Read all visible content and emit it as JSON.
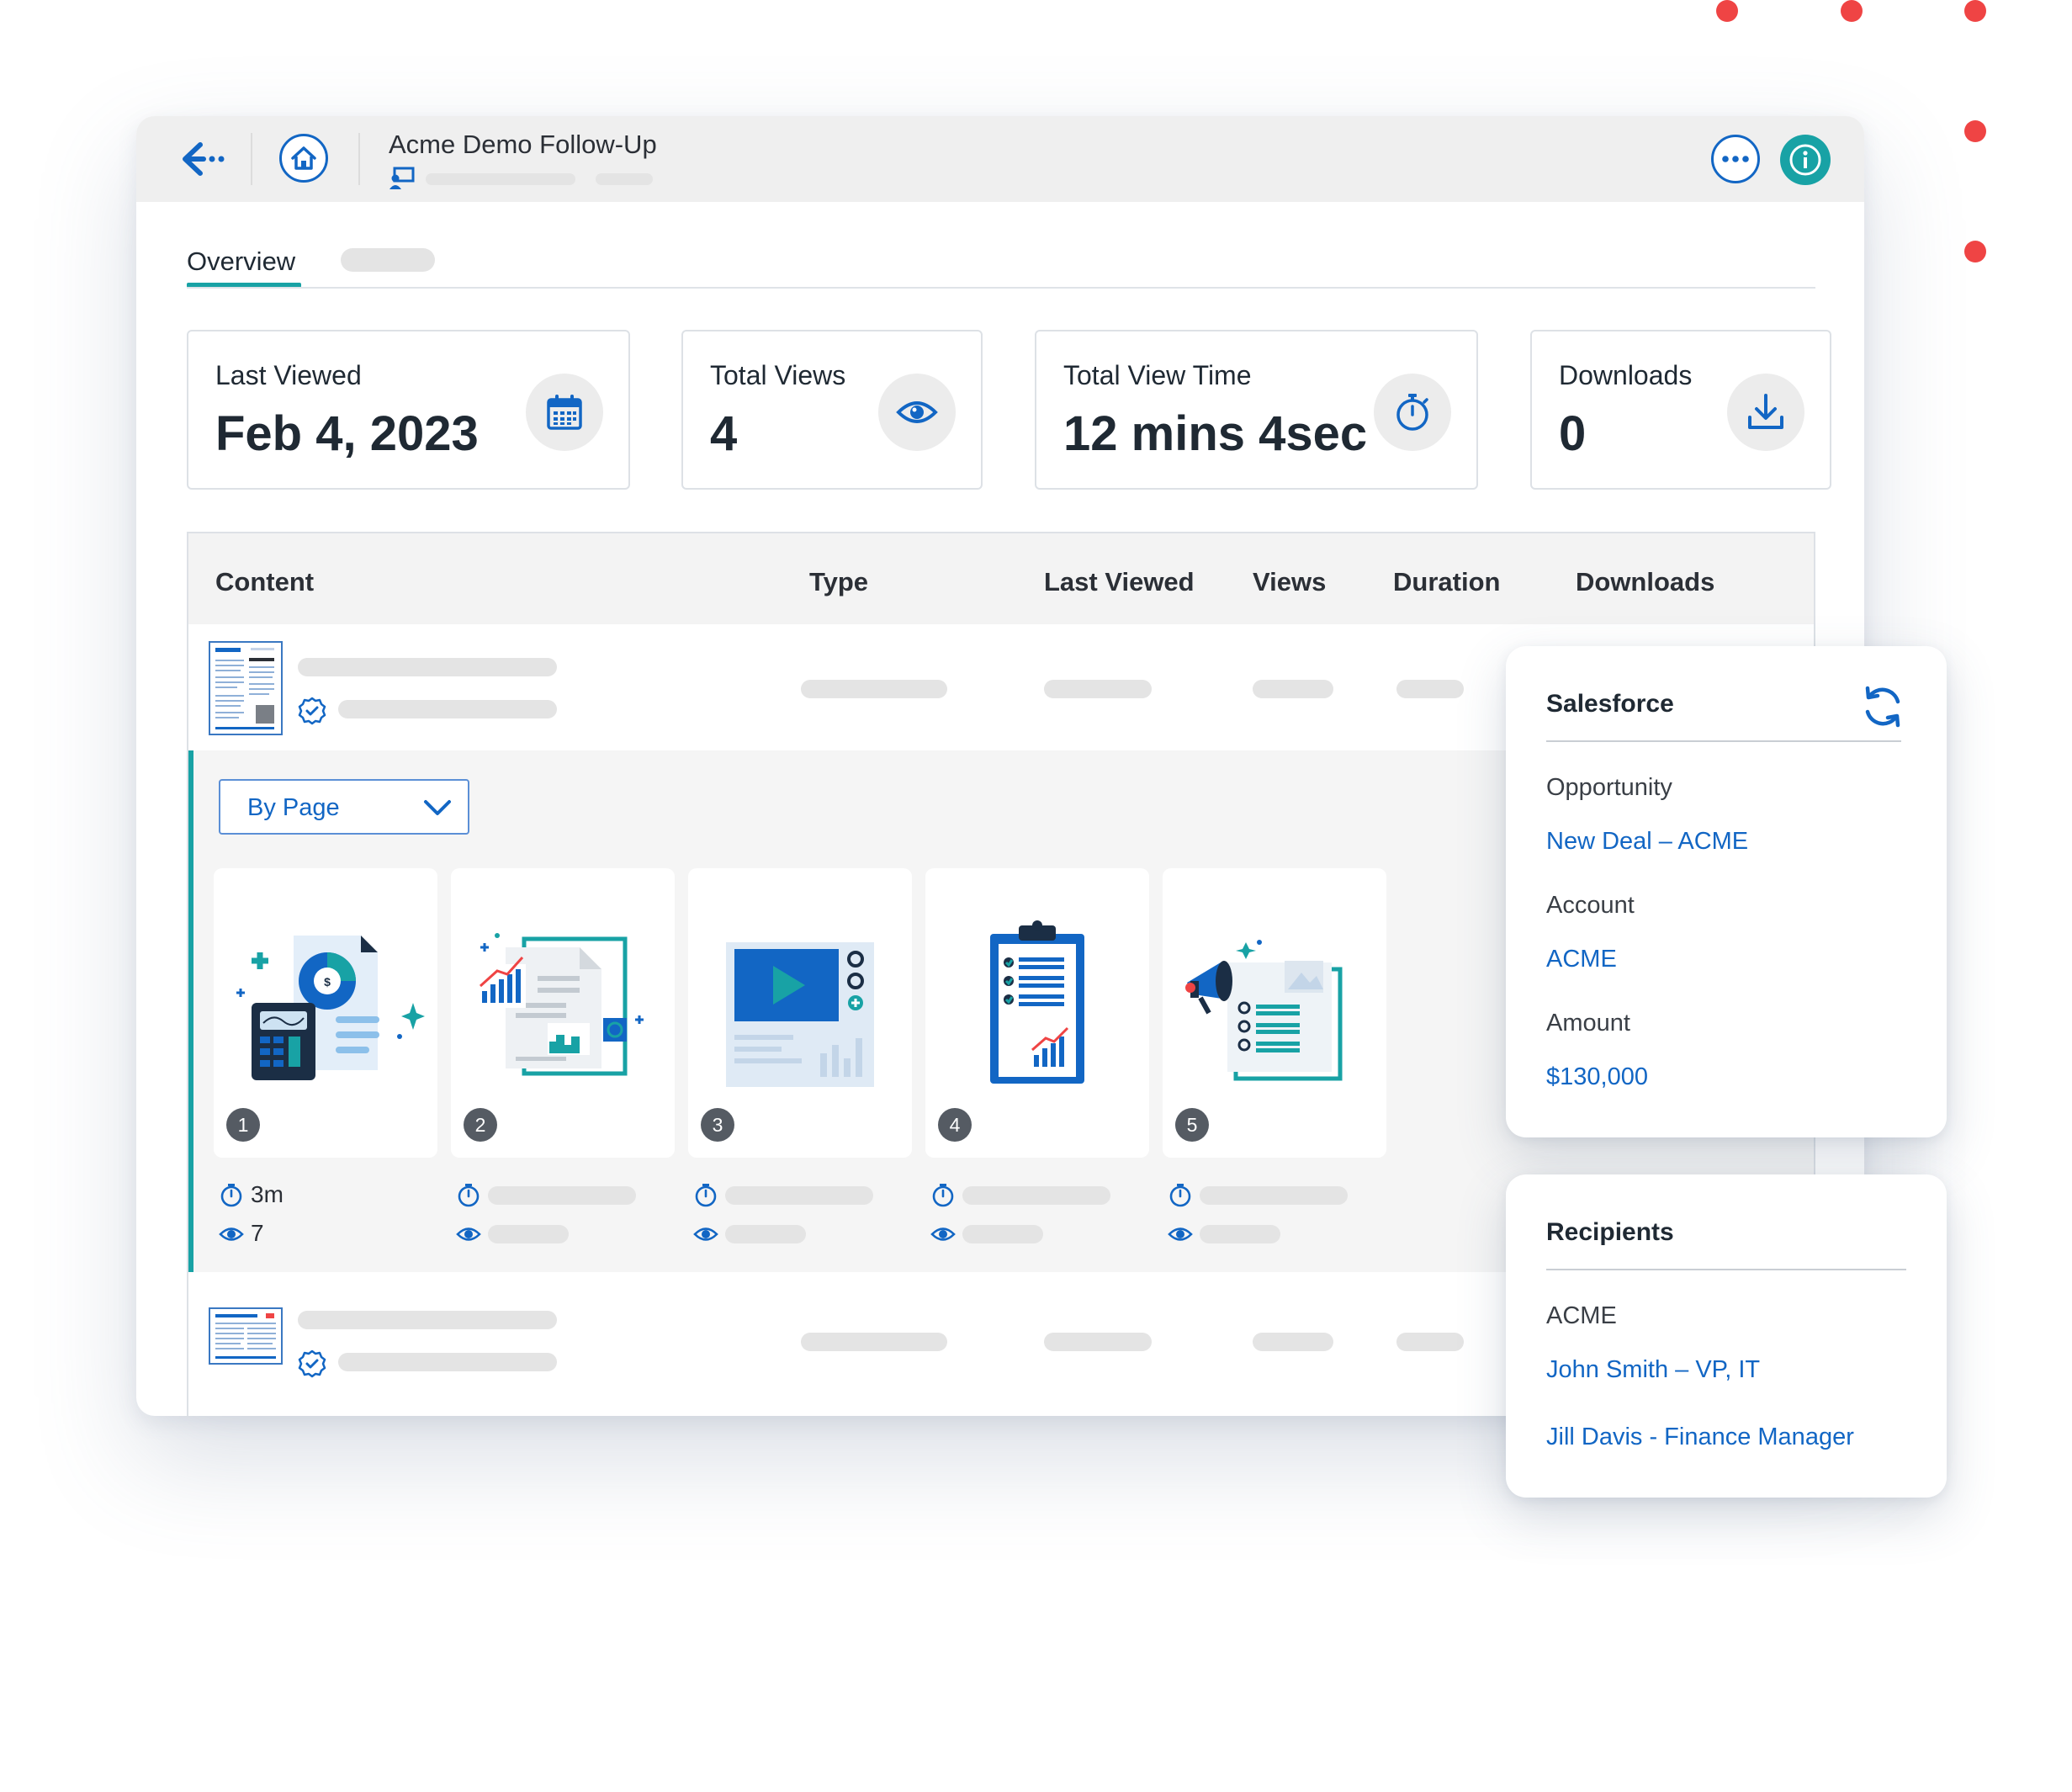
{
  "header": {
    "title": "Acme Demo Follow-Up",
    "back_icon": "back-arrow-icon",
    "home_icon": "home-icon",
    "more_icon": "more-dots-icon",
    "info_icon": "info-icon"
  },
  "tabs": [
    {
      "label": "Overview",
      "active": true
    }
  ],
  "stats": [
    {
      "label": "Last Viewed",
      "value": "Feb 4, 2023",
      "icon": "calendar-icon"
    },
    {
      "label": "Total Views",
      "value": "4",
      "icon": "eye-icon"
    },
    {
      "label": "Total View Time",
      "value": "12 mins 4sec",
      "icon": "stopwatch-icon"
    },
    {
      "label": "Downloads",
      "value": "0",
      "icon": "download-icon"
    }
  ],
  "table": {
    "columns": [
      "Content",
      "Type",
      "Last Viewed",
      "Views",
      "Duration",
      "Downloads"
    ]
  },
  "breakdown": {
    "select_value": "By Page",
    "pages": [
      {
        "number": "1",
        "duration": "3m",
        "views": "7"
      },
      {
        "number": "2"
      },
      {
        "number": "3"
      },
      {
        "number": "4"
      },
      {
        "number": "5"
      }
    ]
  },
  "salesforce": {
    "title": "Salesforce",
    "sync_icon": "sync-icon",
    "fields": [
      {
        "label": "Opportunity",
        "value": "New Deal – ACME"
      },
      {
        "label": "Account",
        "value": "ACME"
      },
      {
        "label": "Amount",
        "value": "$130,000"
      }
    ]
  },
  "recipients": {
    "title": "Recipients",
    "company": "ACME",
    "people": [
      "John Smith – VP, IT",
      "Jill Davis - Finance Manager"
    ]
  },
  "colors": {
    "accent": "#18a2a5",
    "link": "#1266c4",
    "decor_dots": "#ef4444"
  }
}
